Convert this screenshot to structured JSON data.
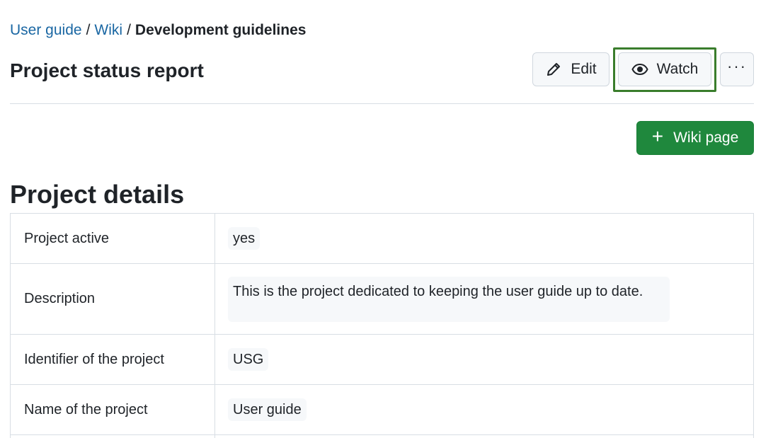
{
  "breadcrumb": {
    "items": [
      {
        "label": "User guide"
      },
      {
        "label": "Wiki"
      }
    ],
    "separator": "/",
    "current": "Development guidelines"
  },
  "page": {
    "title": "Project status report"
  },
  "toolbar": {
    "edit_label": "Edit",
    "edit_icon": "pencil-icon",
    "watch_label": "Watch",
    "watch_icon": "eye-icon",
    "more_label": "···",
    "new_wiki_label": "Wiki page",
    "new_wiki_icon": "plus-icon",
    "new_wiki_plus": "+"
  },
  "colors": {
    "link": "#1a67a3",
    "primary_button": "#1f883d",
    "focus_outline": "#3a7d2c"
  },
  "details": {
    "heading": "Project details",
    "rows": [
      {
        "key": "Project active",
        "value": "yes"
      },
      {
        "key": "Description",
        "value": "This is the project dedicated to keeping the user guide up to date."
      },
      {
        "key": "Identifier of the project",
        "value": "USG"
      },
      {
        "key": "Name of the project",
        "value": "User guide"
      }
    ]
  }
}
